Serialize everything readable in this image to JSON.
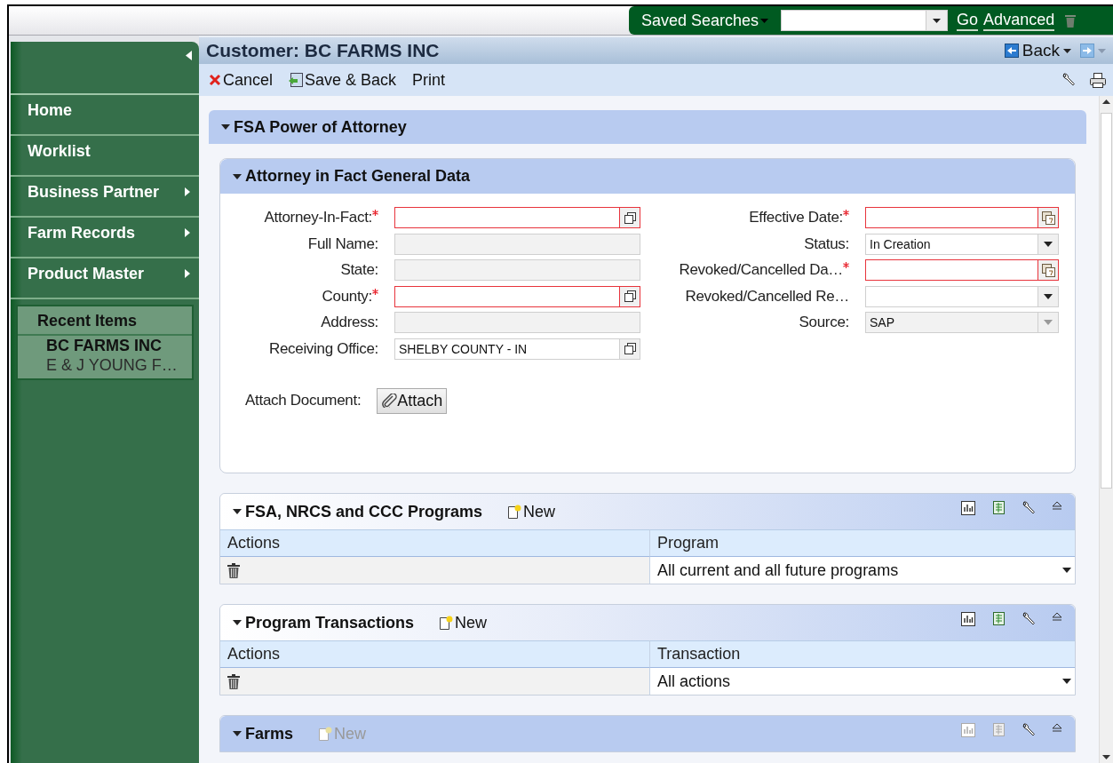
{
  "top_bar": {
    "saved_searches": "Saved Searches",
    "go": "Go",
    "advanced": "Advanced"
  },
  "sidebar": {
    "items": [
      {
        "label": "Home",
        "has_submenu": false
      },
      {
        "label": "Worklist",
        "has_submenu": false
      },
      {
        "label": "Business Partner",
        "has_submenu": true
      },
      {
        "label": "Farm Records",
        "has_submenu": true
      },
      {
        "label": "Product Master",
        "has_submenu": true
      }
    ],
    "recent_items": {
      "title": "Recent Items",
      "items": [
        {
          "label": "BC FARMS INC",
          "selected": true
        },
        {
          "label": "E & J YOUNG F…",
          "selected": false
        }
      ]
    }
  },
  "header": {
    "title": "Customer: BC FARMS INC",
    "back": "Back"
  },
  "toolbar": {
    "buttons": [
      {
        "label": "Cancel",
        "kind": "cancel"
      },
      {
        "label": "Save & Back",
        "kind": "save"
      },
      {
        "label": "Print",
        "kind": "plain"
      }
    ]
  },
  "section": {
    "title": "FSA Power of Attorney",
    "expanded": true
  },
  "general_data": {
    "title": "Attorney in Fact General Data",
    "expanded": true,
    "left_fields": [
      {
        "label": "Attorney-In-Fact:",
        "kind": "lookup",
        "required": true,
        "disabled": false
      },
      {
        "label": "Full Name:",
        "kind": "text",
        "required": false,
        "disabled": true
      },
      {
        "label": "State:",
        "kind": "text",
        "required": false,
        "disabled": true
      },
      {
        "label": "County:",
        "kind": "lookup",
        "required": true,
        "disabled": false
      },
      {
        "label": "Address:",
        "kind": "text",
        "required": false,
        "disabled": true
      },
      {
        "label": "Receiving Office:",
        "kind": "lookup",
        "required": false,
        "disabled": false,
        "value": "SHELBY COUNTY - IN"
      }
    ],
    "right_fields": [
      {
        "label": "Effective Date:",
        "kind": "date",
        "required": true,
        "disabled": false
      },
      {
        "label": "Status:",
        "kind": "select",
        "required": false,
        "disabled": false,
        "value": "In Creation"
      },
      {
        "label": "Revoked/Cancelled Da…",
        "kind": "date",
        "required": true,
        "disabled": false
      },
      {
        "label": "Revoked/Cancelled Re…",
        "kind": "select",
        "required": false,
        "disabled": false
      },
      {
        "label": "Source:",
        "kind": "select",
        "required": false,
        "disabled": true,
        "value": "SAP"
      }
    ],
    "attach": {
      "label": "Attach Document:",
      "button": "Attach"
    }
  },
  "tables": [
    {
      "title": "FSA, NRCS and CCC Programs",
      "new_label": "New",
      "new_disabled": false,
      "columns": [
        "Actions",
        "Program"
      ],
      "rows": [
        {
          "value": "All current and all future programs"
        }
      ]
    },
    {
      "title": "Program Transactions",
      "new_label": "New",
      "new_disabled": false,
      "columns": [
        "Actions",
        "Transaction"
      ],
      "rows": [
        {
          "value": "All actions"
        }
      ]
    },
    {
      "title": "Farms",
      "new_label": "New",
      "new_disabled": true
    }
  ]
}
